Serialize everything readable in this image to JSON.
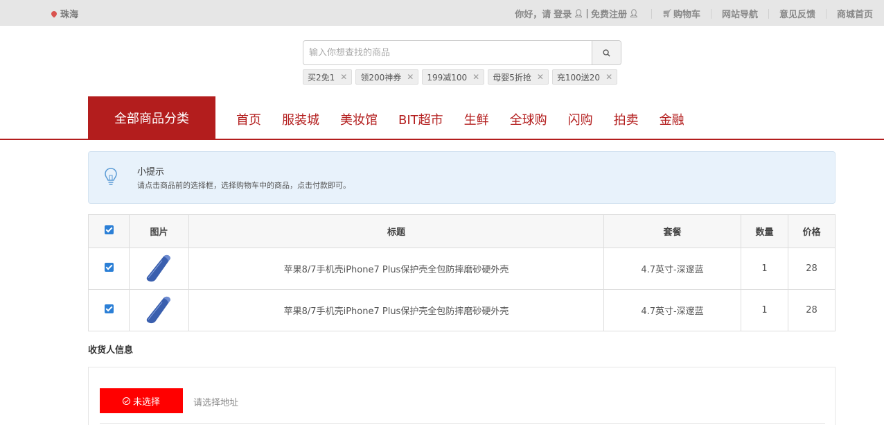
{
  "topbar": {
    "location": "珠海",
    "greeting": "你好，请",
    "login": "登录",
    "divider": "|",
    "register": "免费注册",
    "cart": "购物车",
    "site_nav": "网站导航",
    "feedback": "意见反馈",
    "home": "商城首页"
  },
  "search": {
    "placeholder": "输入你想查找的商品",
    "tags": [
      "买2免1",
      "领200神券",
      "199减100",
      "母婴5折抢",
      "充100送20"
    ]
  },
  "nav": {
    "all_categories": "全部商品分类",
    "links": [
      "首页",
      "服装城",
      "美妆馆",
      "BIT超市",
      "生鲜",
      "全球购",
      "闪购",
      "拍卖",
      "金融"
    ]
  },
  "tip": {
    "title": "小提示",
    "text": "请点击商品前的选择框，选择购物车中的商品，点击付款即可。"
  },
  "cart_table": {
    "headers": [
      "图片",
      "标题",
      "套餐",
      "数量",
      "价格"
    ],
    "rows": [
      {
        "title": "苹果8/7手机壳iPhone7 Plus保护壳全包防摔磨砂硬外壳",
        "spec": "4.7英寸-深邃蓝",
        "qty": "1",
        "price": "28"
      },
      {
        "title": "苹果8/7手机壳iPhone7 Plus保护壳全包防摔磨砂硬外壳",
        "spec": "4.7英寸-深邃蓝",
        "qty": "1",
        "price": "28"
      }
    ]
  },
  "consignee": {
    "title": "收货人信息",
    "button": "未选择",
    "hint": "请选择地址"
  },
  "colors": {
    "brand_red": "#b31d1d",
    "button_red": "#ff0000",
    "checkbox_blue": "#2b7fd6",
    "tip_bg": "#e8f2fb"
  }
}
